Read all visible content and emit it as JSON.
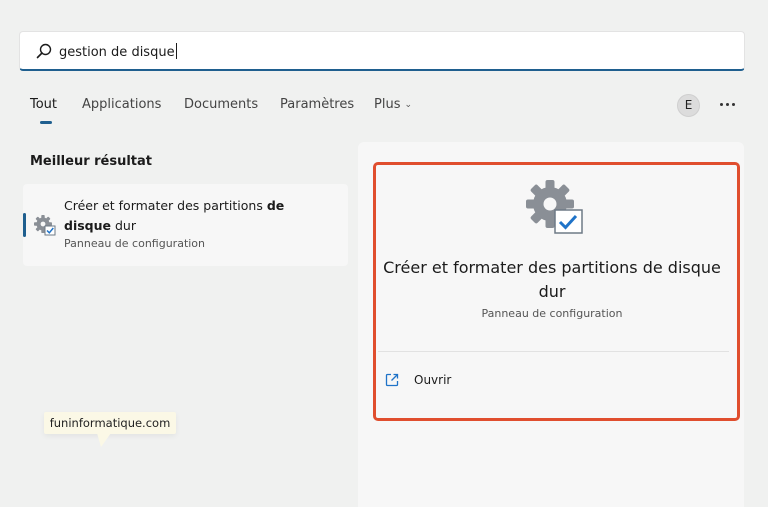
{
  "search": {
    "query": "gestion de disque"
  },
  "tabs": [
    {
      "label": "Tout",
      "active": true
    },
    {
      "label": "Applications",
      "active": false
    },
    {
      "label": "Documents",
      "active": false
    },
    {
      "label": "Paramètres",
      "active": false
    },
    {
      "label": "Plus",
      "active": false
    }
  ],
  "user": {
    "avatar_initial": "E"
  },
  "best_match": {
    "heading": "Meilleur résultat",
    "title_part1": "Créer et formater des partitions ",
    "title_bold1": "de",
    "title_bold2": "disque",
    "title_part2": " dur",
    "subtitle": "Panneau de configuration",
    "icon": "settings-gear-check-icon"
  },
  "detail": {
    "title": "Créer et formater des partitions de disque dur",
    "subtitle": "Panneau de configuration",
    "icon": "settings-gear-check-icon",
    "actions": [
      {
        "label": "Ouvrir",
        "icon": "open-external-icon"
      }
    ]
  },
  "watermark": {
    "text": "funinformatique.com"
  },
  "colors": {
    "accent": "#1f5f8f",
    "highlight": "#e04e2e",
    "background": "#f0f1f0"
  }
}
